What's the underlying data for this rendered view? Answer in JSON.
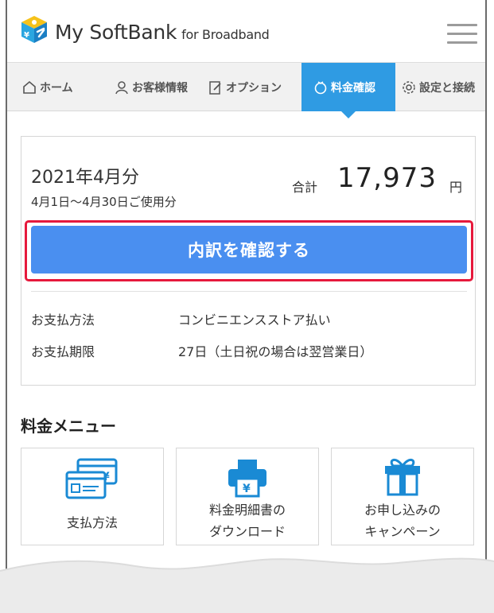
{
  "header": {
    "brand": "My SoftBank",
    "brand_sub": "for Broadband",
    "menu_icon": "hamburger-icon",
    "logo_icon": "softbank-cube-logo"
  },
  "tabs": [
    {
      "label": "ホーム",
      "icon": "house-icon",
      "active": false
    },
    {
      "label": "お客様情報",
      "icon": "person-icon",
      "active": false
    },
    {
      "label": "オプション",
      "icon": "document-edit-icon",
      "active": false
    },
    {
      "label": "料金確認",
      "icon": "coin-icon",
      "active": true
    },
    {
      "label": "設定と接続",
      "icon": "gear-icon",
      "active": false
    }
  ],
  "bill": {
    "month": "2021年4月分",
    "period": "4月1日〜4月30日ご使用分",
    "total_label": "合計",
    "total_value": "17,973",
    "total_unit": "円",
    "detail_button": "内訳を確認する",
    "payment_method_label": "お支払方法",
    "payment_method_value": "コンビニエンスストア払い",
    "due_label": "お支払期限",
    "due_value": "27日（土日祝の場合は翌営業日）"
  },
  "menu": {
    "title": "料金メニュー",
    "items": [
      {
        "line1": "支払方法",
        "line2": "",
        "icon": "payment-cards-icon"
      },
      {
        "line1": "料金明細書の",
        "line2": "ダウンロード",
        "icon": "printer-icon"
      },
      {
        "line1": "お申し込みの",
        "line2": "キャンペーン",
        "icon": "gift-icon"
      }
    ]
  },
  "colors": {
    "tab_active": "#2f9be3",
    "button": "#4a8ff0",
    "highlight": "#e6193c",
    "icon_blue": "#1a8ad4"
  }
}
